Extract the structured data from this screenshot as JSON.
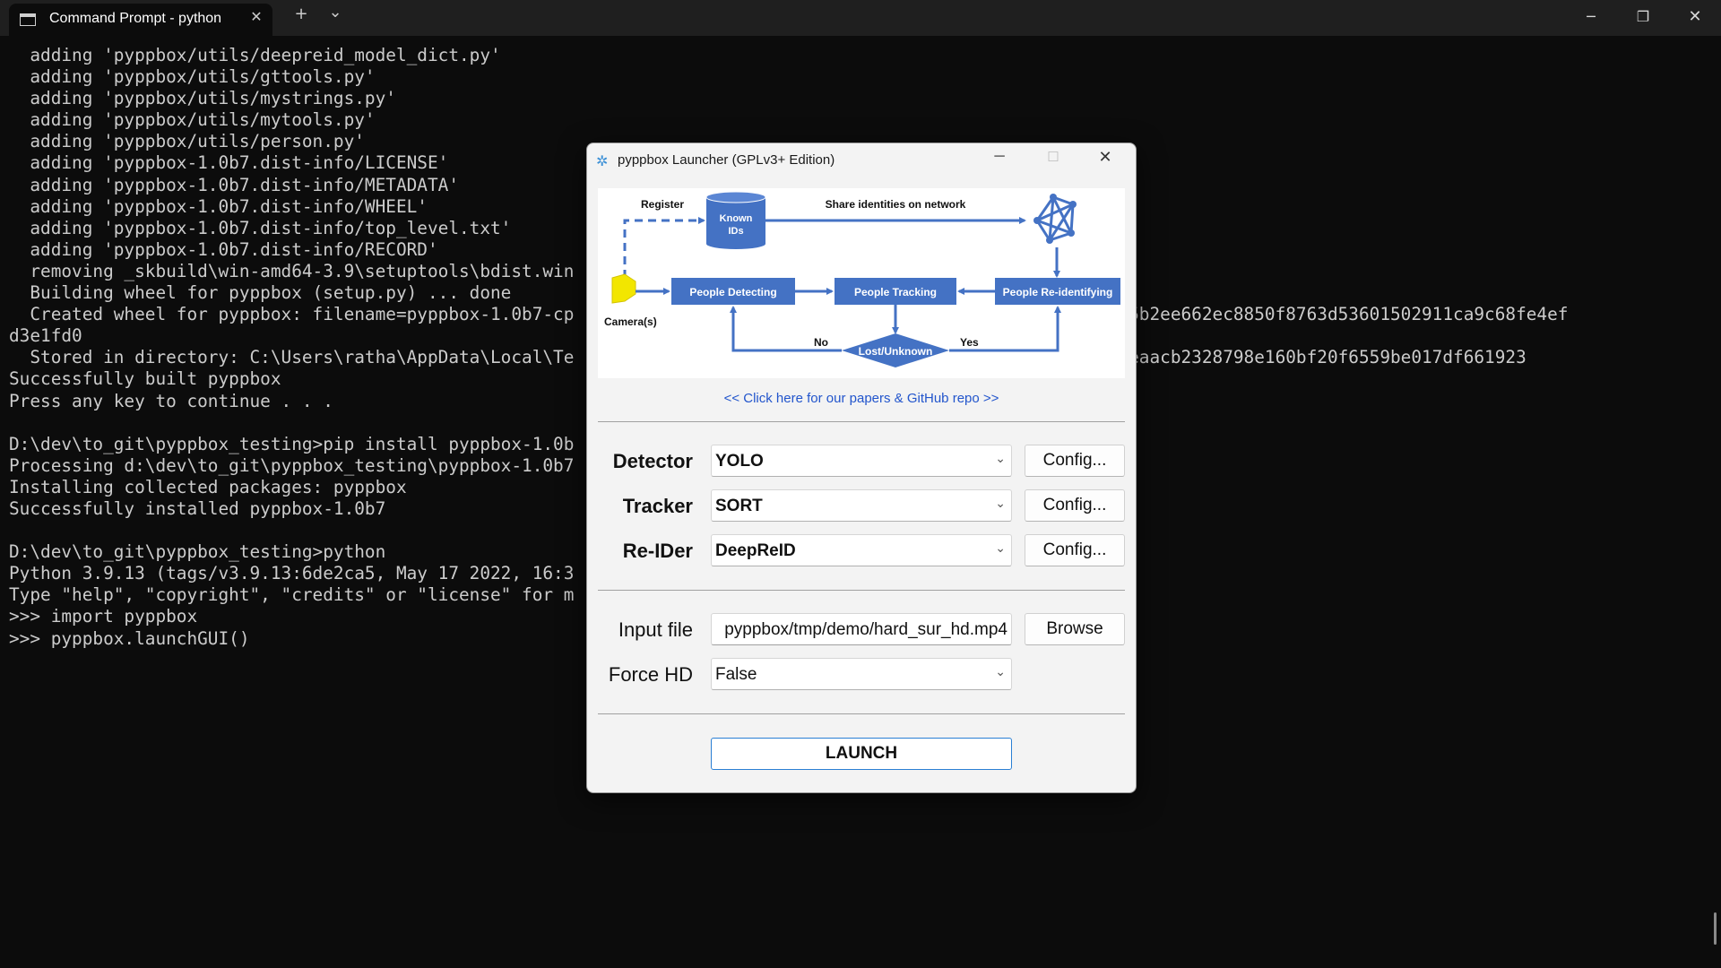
{
  "terminal": {
    "tab_title": "Command Prompt - python",
    "new_tab": "+",
    "tab_dropdown": "⌄",
    "lines": [
      "  adding 'pyppbox/utils/deepreid_model_dict.py'",
      "  adding 'pyppbox/utils/gttools.py'",
      "  adding 'pyppbox/utils/mystrings.py'",
      "  adding 'pyppbox/utils/mytools.py'",
      "  adding 'pyppbox/utils/person.py'",
      "  adding 'pyppbox-1.0b7.dist-info/LICENSE'",
      "  adding 'pyppbox-1.0b7.dist-info/METADATA'",
      "  adding 'pyppbox-1.0b7.dist-info/WHEEL'",
      "  adding 'pyppbox-1.0b7.dist-info/top_level.txt'",
      "  adding 'pyppbox-1.0b7.dist-info/RECORD'",
      "  removing _skbuild\\win-amd64-3.9\\setuptools\\bdist.win",
      "  Building wheel for pyppbox (setup.py) ... done",
      "  Created wheel for pyppbox: filename=pyppbox-1.0b7-cp                                            846485c585b2ee662ec8850f8763d53601502911ca9c68fe4ef",
      "d3e1fd0",
      "  Stored in directory: C:\\Users\\ratha\\AppData\\Local\\Te                                          0b638d21924eaacb2328798e160bf20f6559be017df661923",
      "Successfully built pyppbox",
      "Press any key to continue . . .",
      "",
      "D:\\dev\\to_git\\pyppbox_testing>pip install pyppbox-1.0b",
      "Processing d:\\dev\\to_git\\pyppbox_testing\\pyppbox-1.0b7",
      "Installing collected packages: pyppbox",
      "Successfully installed pyppbox-1.0b7",
      "",
      "D:\\dev\\to_git\\pyppbox_testing>python",
      "Python 3.9.13 (tags/v3.9.13:6de2ca5, May 17 2022, 16:3",
      "Type \"help\", \"copyright\", \"credits\" or \"license\" for m",
      ">>> import pyppbox",
      ">>> pyppbox.launchGUI()"
    ]
  },
  "dialog": {
    "title": "pyppbox Launcher (GPLv3+ Edition)",
    "diagram": {
      "register": "Register",
      "known_ids_1": "Known",
      "known_ids_2": "IDs",
      "share": "Share identities on network",
      "camera": "Camera(s)",
      "detecting": "People Detecting",
      "tracking": "People Tracking",
      "reidentifying": "People Re-identifying",
      "no": "No",
      "yes": "Yes",
      "lost": "Lost/Unknown",
      "colors": {
        "blue": "#4472c4",
        "camera": "#f2e600"
      }
    },
    "link": "<< Click here for our papers & GitHub repo >>",
    "detector": {
      "label": "Detector",
      "value": "YOLO",
      "config": "Config..."
    },
    "tracker": {
      "label": "Tracker",
      "value": "SORT",
      "config": "Config..."
    },
    "reider": {
      "label": "Re-IDer",
      "value": "DeepReID",
      "config": "Config..."
    },
    "input_file": {
      "label": "Input file",
      "value": "pyppbox/tmp/demo/hard_sur_hd.mp4",
      "browse": "Browse"
    },
    "force_hd": {
      "label": "Force HD",
      "value": "False"
    },
    "launch": "LAUNCH"
  }
}
